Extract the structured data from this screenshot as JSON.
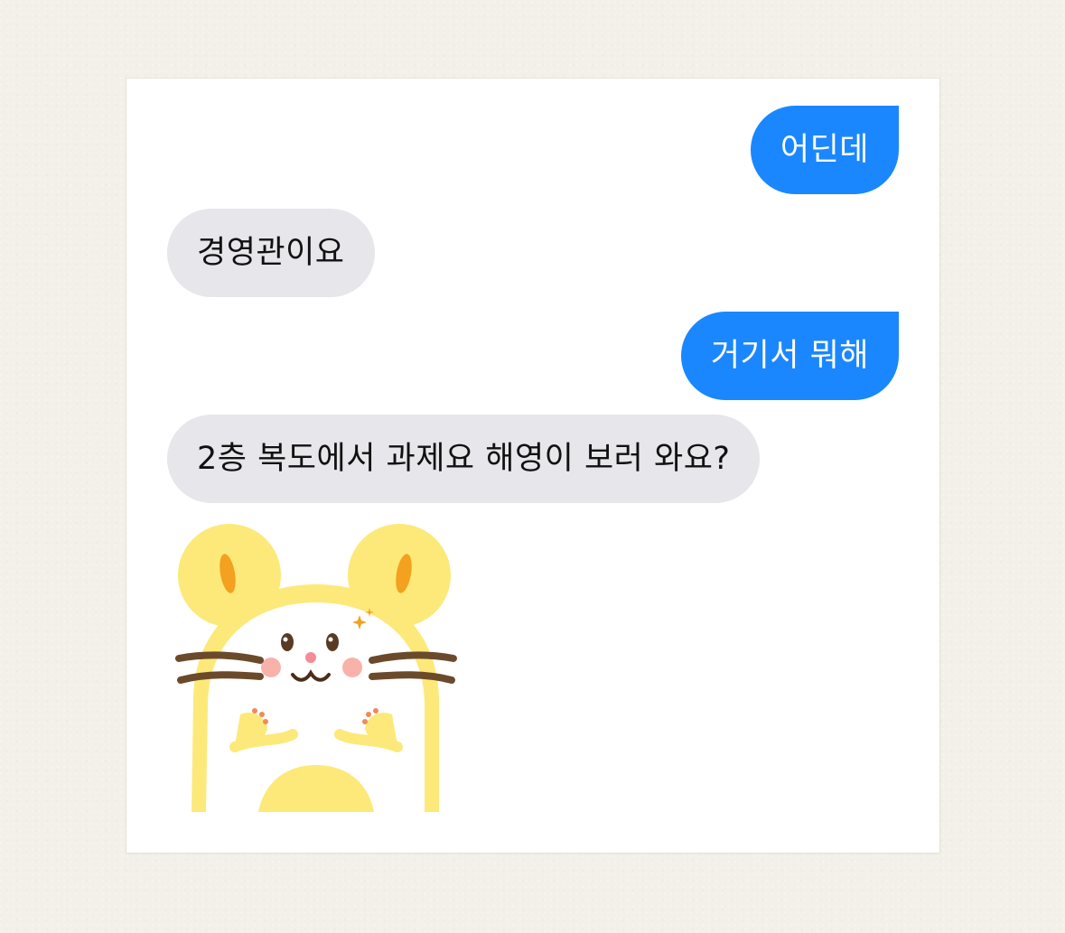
{
  "messages": [
    {
      "sender": "me",
      "text": "어딘데"
    },
    {
      "sender": "other",
      "text": "경영관이요"
    },
    {
      "sender": "me",
      "text": "거기서 뭐해"
    },
    {
      "sender": "other",
      "text": "2층 복도에서 과제요 해영이 보러 와요?"
    }
  ],
  "sticker": {
    "icon": "hamster-sticker-icon"
  },
  "colors": {
    "outgoing_bubble": "#1a87ff",
    "incoming_bubble": "#e6e6eb",
    "background": "#f2f0e8"
  }
}
